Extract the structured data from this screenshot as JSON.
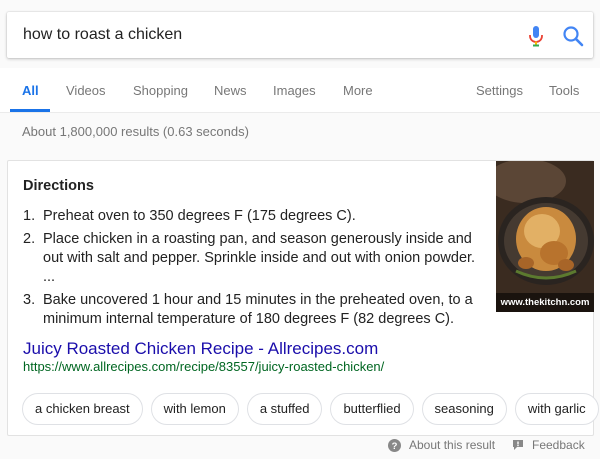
{
  "search": {
    "query": "how to roast a chicken"
  },
  "tabs": [
    {
      "label": "All",
      "active": true
    },
    {
      "label": "Videos"
    },
    {
      "label": "Shopping"
    },
    {
      "label": "News"
    },
    {
      "label": "Images"
    },
    {
      "label": "More"
    }
  ],
  "tools": {
    "settings": "Settings",
    "tools": "Tools"
  },
  "result_stats": "About 1,800,000 results (0.63 seconds)",
  "featured_snippet": {
    "heading": "Directions",
    "steps": [
      {
        "num": "1.",
        "text": "Preheat oven to 350 degrees F (175 degrees C)."
      },
      {
        "num": "2.",
        "text": "Place chicken in a roasting pan, and season generously inside and out with salt and pepper. Sprinkle inside and out with onion powder. ..."
      },
      {
        "num": "3.",
        "text": "Bake uncovered 1 hour and 15 minutes in the preheated oven, to a minimum internal temperature of 180 degrees F (82 degrees C)."
      }
    ],
    "image_caption": "www.thekitchn.com",
    "source_title": "Juicy Roasted Chicken Recipe - Allrecipes.com",
    "source_url": "https://www.allrecipes.com/recipe/83557/juicy-roasted-chicken/"
  },
  "related_chips": [
    "a chicken breast",
    "with lemon",
    "a stuffed",
    "butterflied",
    "seasoning",
    "with garlic"
  ],
  "footer": {
    "about": "About this result",
    "feedback": "Feedback"
  },
  "colors": {
    "link": "#1a0dab",
    "url": "#006621",
    "accent": "#1a73e8",
    "muted": "#777777"
  },
  "icons": [
    "microphone-icon",
    "search-icon",
    "help-circle-icon",
    "feedback-icon"
  ]
}
